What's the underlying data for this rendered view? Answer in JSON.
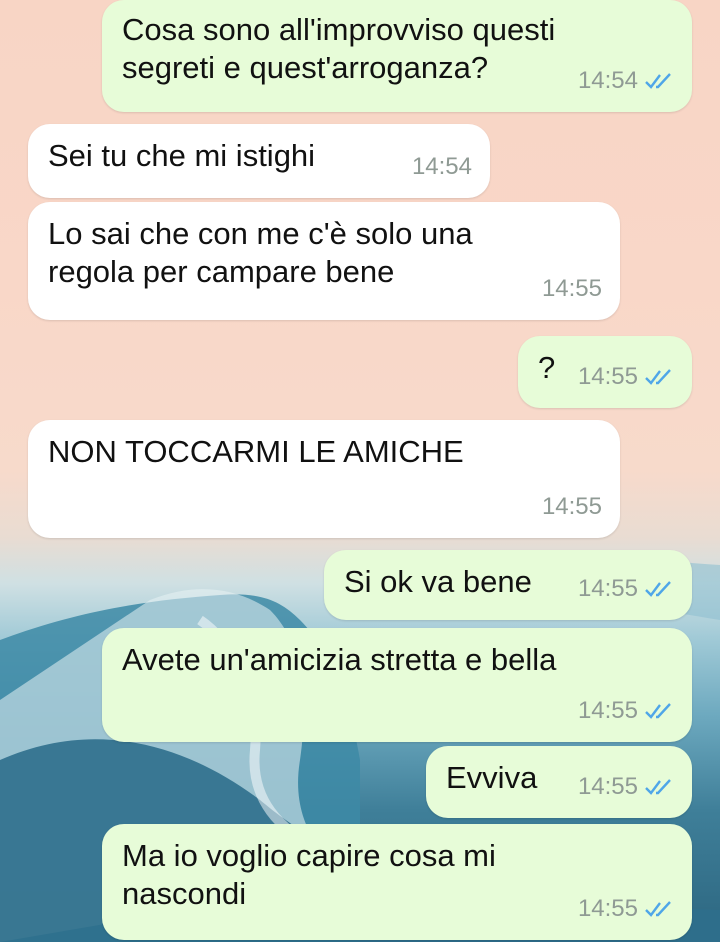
{
  "messages": [
    {
      "direction": "out",
      "text": "Cosa sono all'improvviso questi\nsegreti e quest'arroganza?",
      "time": "14:54",
      "read": true
    },
    {
      "direction": "in",
      "text": "Sei tu che mi istighi",
      "time": "14:54"
    },
    {
      "direction": "in",
      "text": "Lo sai che con me c'è solo una\nregola per campare bene",
      "time": "14:55"
    },
    {
      "direction": "out",
      "text": "?",
      "time": "14:55",
      "read": true
    },
    {
      "direction": "in",
      "text": "NON TOCCARMI LE AMICHE",
      "time": "14:55"
    },
    {
      "direction": "out",
      "text": "Si ok va bene",
      "time": "14:55",
      "read": true
    },
    {
      "direction": "out",
      "text": "Avete un'amicizia stretta e bella",
      "time": "14:55",
      "read": true
    },
    {
      "direction": "out",
      "text": "Evviva",
      "time": "14:55",
      "read": true
    },
    {
      "direction": "out",
      "text": "Ma io voglio capire cosa mi\nnascondi",
      "time": "14:55",
      "read": true
    }
  ],
  "colors": {
    "incoming_bubble": "#ffffff",
    "outgoing_bubble": "#e7fcd8",
    "read_tick": "#4fa6e8",
    "timestamp": "#8f9a94"
  },
  "icons": {
    "read_receipt": "double-check-icon"
  }
}
